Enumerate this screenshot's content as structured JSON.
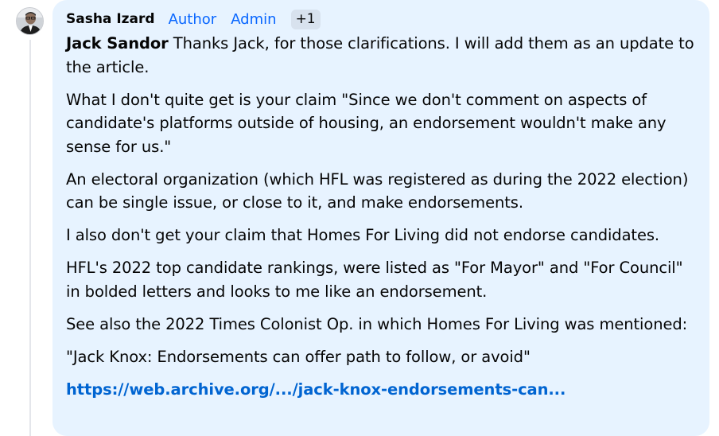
{
  "comment": {
    "author": "Sasha Izard",
    "badges": [
      "Author",
      "Admin"
    ],
    "extra_badges": "+1",
    "mention": "Jack Sandor",
    "first_paragraph_rest": " Thanks Jack, for those clarifications. I will add them as an update to the article.",
    "paragraphs": [
      "What I don't quite get is your claim \"Since we don't comment on aspects of candidate's platforms outside of housing, an endorsement wouldn't make any sense for us.\"",
      "An electoral organization (which HFL was registered as during the 2022 election) can be single issue, or close to it, and make endorsements.",
      "I also don't get your claim that Homes For Living did not endorse candidates.",
      "HFL's 2022 top candidate rankings, were listed as \"For Mayor\" and \"For Council\" in bolded letters and looks to me like an endorsement.",
      "See also the 2022 Times Colonist Op. in which Homes For Living was mentioned:",
      "\"Jack Knox: Endorsements can offer path to follow, or avoid\""
    ],
    "link_text": "https://web.archive.org/.../jack-knox-endorsements-can..."
  },
  "avatar_icon": "person-avatar-icon"
}
